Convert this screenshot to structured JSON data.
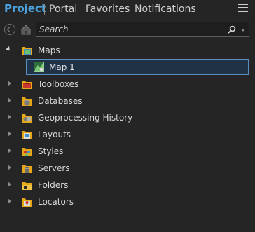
{
  "tabs": [
    {
      "label": "Project",
      "active": true
    },
    {
      "label": "Portal",
      "active": false
    },
    {
      "label": "Favorites",
      "active": false
    },
    {
      "label": "Notifications",
      "active": false
    }
  ],
  "search": {
    "placeholder": "Search"
  },
  "tree": {
    "maps": {
      "label": "Maps",
      "expanded": true,
      "children": [
        {
          "label": "Map 1",
          "selected": true
        }
      ]
    },
    "items": [
      {
        "label": "Toolboxes",
        "icon": "toolbox-folder-icon"
      },
      {
        "label": "Databases",
        "icon": "database-folder-icon"
      },
      {
        "label": "Geoprocessing History",
        "icon": "history-folder-icon"
      },
      {
        "label": "Layouts",
        "icon": "layout-folder-icon"
      },
      {
        "label": "Styles",
        "icon": "style-folder-icon"
      },
      {
        "label": "Servers",
        "icon": "server-folder-icon"
      },
      {
        "label": "Folders",
        "icon": "folder-icon"
      },
      {
        "label": "Locators",
        "icon": "locator-folder-icon"
      }
    ]
  },
  "colors": {
    "accent": "#4aa3df",
    "background": "#252526",
    "selection": "#1f3246",
    "selection_border": "#5a8dc0",
    "folder": "#e6a817"
  }
}
